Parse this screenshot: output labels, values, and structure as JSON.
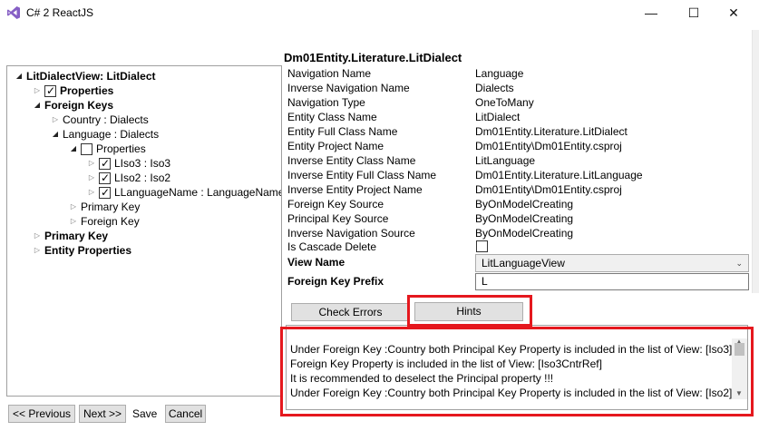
{
  "window": {
    "title": "C# 2 ReactJS",
    "icon": "visual-studio-icon",
    "controls": {
      "minimize": "—",
      "maximize": "☐",
      "close": "✕"
    }
  },
  "tree": {
    "items": [
      {
        "label": "LitDialectView: LitDialect",
        "bold": true,
        "expander": "expanded",
        "checkbox": null
      },
      {
        "label": "Properties",
        "bold": true,
        "expander": "collapsed",
        "checkbox": "checked"
      },
      {
        "label": "Foreign Keys",
        "bold": true,
        "expander": "expanded",
        "checkbox": null
      },
      {
        "label": "Country : Dialects",
        "bold": false,
        "expander": "collapsed",
        "checkbox": null
      },
      {
        "label": "Language : Dialects",
        "bold": false,
        "expander": "expanded",
        "checkbox": null
      },
      {
        "label": "Properties",
        "bold": false,
        "expander": "expanded",
        "checkbox": "unchecked"
      },
      {
        "label": "LIso3 : Iso3",
        "bold": false,
        "expander": "collapsed",
        "checkbox": "checked"
      },
      {
        "label": "LIso2 : Iso2",
        "bold": false,
        "expander": "collapsed",
        "checkbox": "checked"
      },
      {
        "label": "LLanguageName : LanguageName",
        "bold": false,
        "expander": "collapsed",
        "checkbox": "checked"
      },
      {
        "label": "Primary Key",
        "bold": false,
        "expander": "collapsed",
        "checkbox": null
      },
      {
        "label": "Foreign Key",
        "bold": false,
        "expander": "collapsed",
        "checkbox": null
      },
      {
        "label": "Primary Key",
        "bold": true,
        "expander": "collapsed",
        "checkbox": null
      },
      {
        "label": "Entity Properties",
        "bold": true,
        "expander": "collapsed",
        "checkbox": null
      }
    ]
  },
  "details": {
    "title": "Dm01Entity.Literature.LitDialect",
    "properties": [
      {
        "label": "Navigation Name",
        "value": "Language"
      },
      {
        "label": "Inverse Navigation Name",
        "value": "Dialects"
      },
      {
        "label": "Navigation Type",
        "value": "OneToMany"
      },
      {
        "label": "Entity Class Name",
        "value": "LitDialect"
      },
      {
        "label": "Entity Full Class Name",
        "value": "Dm01Entity.Literature.LitDialect"
      },
      {
        "label": "Entity Project Name",
        "value": "Dm01Entity\\Dm01Entity.csproj"
      },
      {
        "label": "Inverse Entity Class Name",
        "value": "LitLanguage"
      },
      {
        "label": "Inverse Entity Full Class Name",
        "value": "Dm01Entity.Literature.LitLanguage"
      },
      {
        "label": "Inverse Entity Project Name",
        "value": "Dm01Entity\\Dm01Entity.csproj"
      },
      {
        "label": "Foreign Key Source",
        "value": "ByOnModelCreating"
      },
      {
        "label": "Principal Key Source",
        "value": "ByOnModelCreating"
      },
      {
        "label": "Inverse Navigation Source",
        "value": "ByOnModelCreating"
      }
    ],
    "cascade_label": "Is Cascade Delete",
    "cascade_checked": false,
    "view_name_label": "View Name",
    "view_name_value": "LitLanguageView",
    "fk_prefix_label": "Foreign Key Prefix",
    "fk_prefix_value": "L"
  },
  "actions": {
    "check_errors": "Check Errors",
    "hints": "Hints"
  },
  "hints_output": {
    "lines": [
      "Under Foreign Key :Country  both Principal Key Property is included in the list of View: [Iso3]",
      "Foreign Key Property is included in the list of View: [Iso3CntrRef]",
      "It is recommended to deselect the Principal property !!!",
      "Under Foreign Key :Country  both Principal Key Property is included in the list of View: [Iso2]"
    ]
  },
  "footer": {
    "previous": "<< Previous",
    "next": "Next >>",
    "save": "Save",
    "cancel": "Cancel"
  },
  "colors": {
    "highlight": "#e5181e",
    "button_bg": "#e1e1e1",
    "vs_purple": "#865fc5"
  }
}
